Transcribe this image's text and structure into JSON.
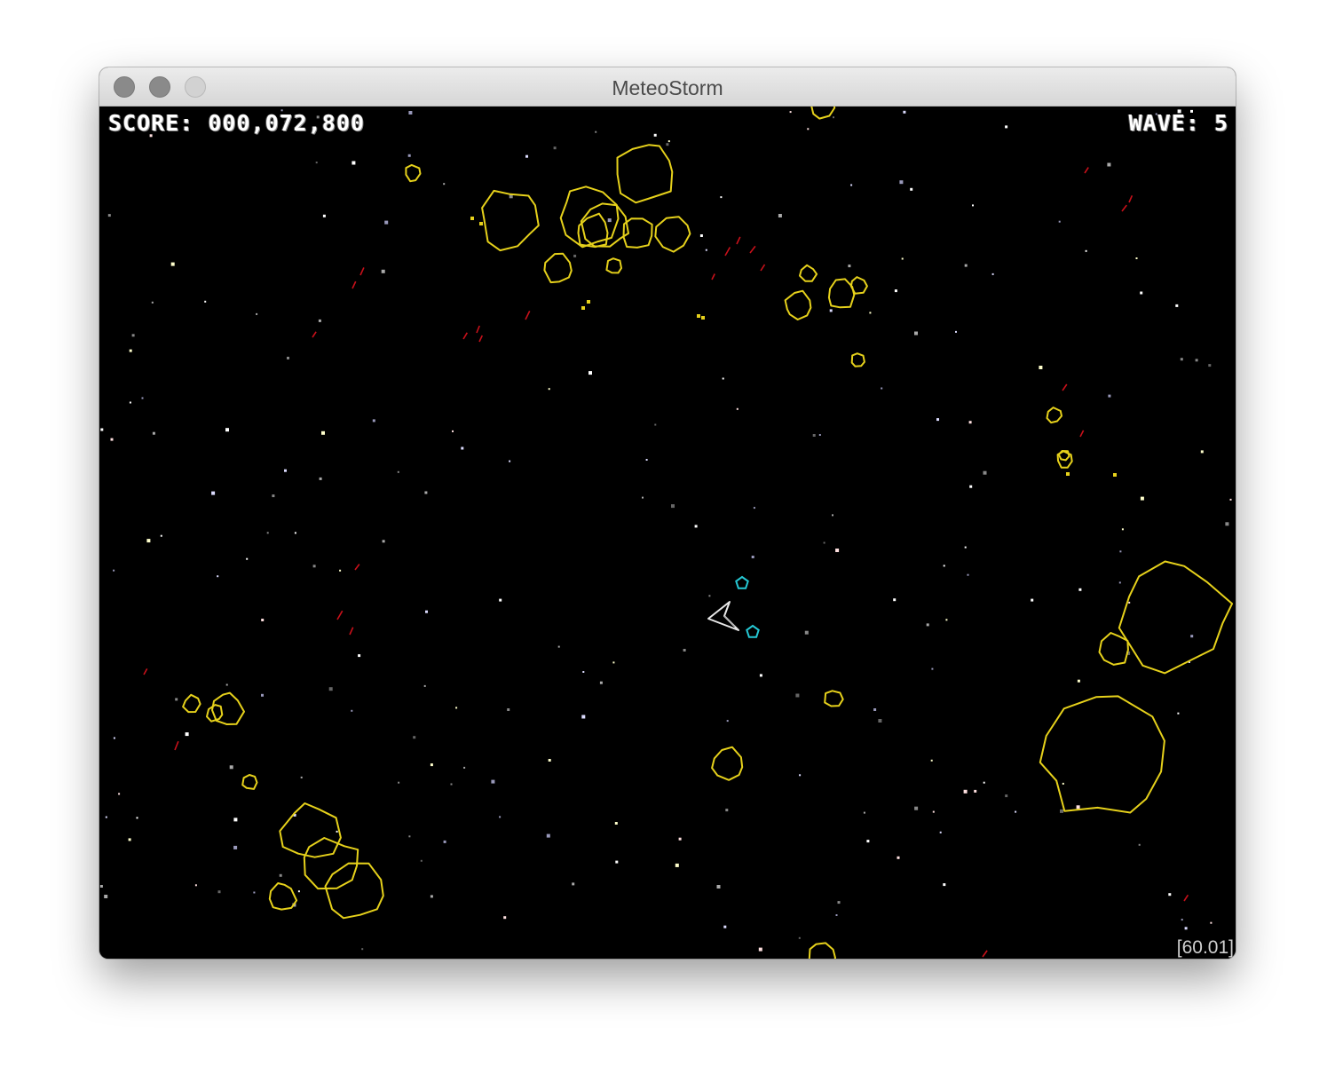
{
  "window": {
    "title": "MeteoStorm"
  },
  "hud": {
    "score_label": "SCORE:",
    "score_value": "000,072,800",
    "wave_label": "WAVE:",
    "wave_value": "5",
    "fps": "[60.01]"
  },
  "colors": {
    "background": "#000000",
    "asteroid": "#e6d11b",
    "player_ship": "#e8e8e8",
    "escort_drone": "#25c8d4",
    "debris": "#c8101a",
    "hud_text": "#ffffff"
  },
  "scene": {
    "player_ship": "arrow-ship-icon",
    "escort_drones": 2,
    "asteroid_outline": "polygon"
  }
}
